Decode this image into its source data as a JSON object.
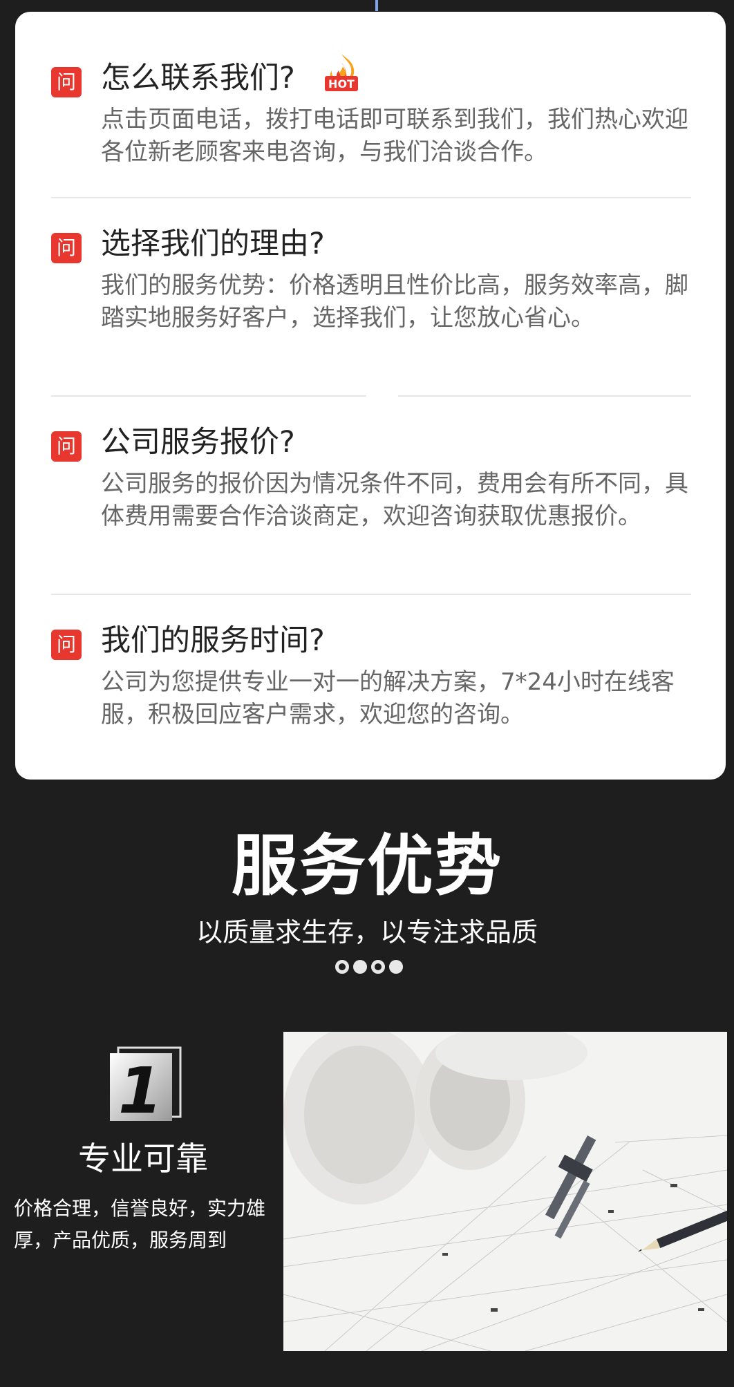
{
  "faq": [
    {
      "badge": "问",
      "question": "怎么联系我们?",
      "hot_icon": "fire-hot-icon",
      "answer": "点击页面电话，拨打电话即可联系到我们，我们热心欢迎各位新老顾客来电咨询，与我们洽谈合作。"
    },
    {
      "badge": "问",
      "question": "选择我们的理由?",
      "answer": "我们的服务优势：价格透明且性价比高，服务效率高，脚踏实地服务好客户，选择我们，让您放心省心。"
    },
    {
      "badge": "问",
      "question": "公司服务报价?",
      "answer": "公司服务的报价因为情况条件不同，费用会有所不同，具体费用需要合作洽谈商定，欢迎咨询获取优惠报价。"
    },
    {
      "badge": "问",
      "question": "我们的服务时间?",
      "answer": "公司为您提供专业一对一的解决方案，7*24小时在线客服，积极回应客户需求，欢迎您的咨询。"
    }
  ],
  "hot_label": "HOT",
  "advantages": {
    "title": "服务优势",
    "subtitle": "以质量求生存，以专注求品质",
    "feature": {
      "number": "1",
      "title": "专业可靠",
      "description": "价格合理，信誉良好，实力雄厚，产品优质，服务周到",
      "image_icon": "blueprint-drafting-tools-image"
    }
  },
  "colors": {
    "badge": "#e8372f",
    "background": "#1e1e1e",
    "card": "#ffffff"
  }
}
